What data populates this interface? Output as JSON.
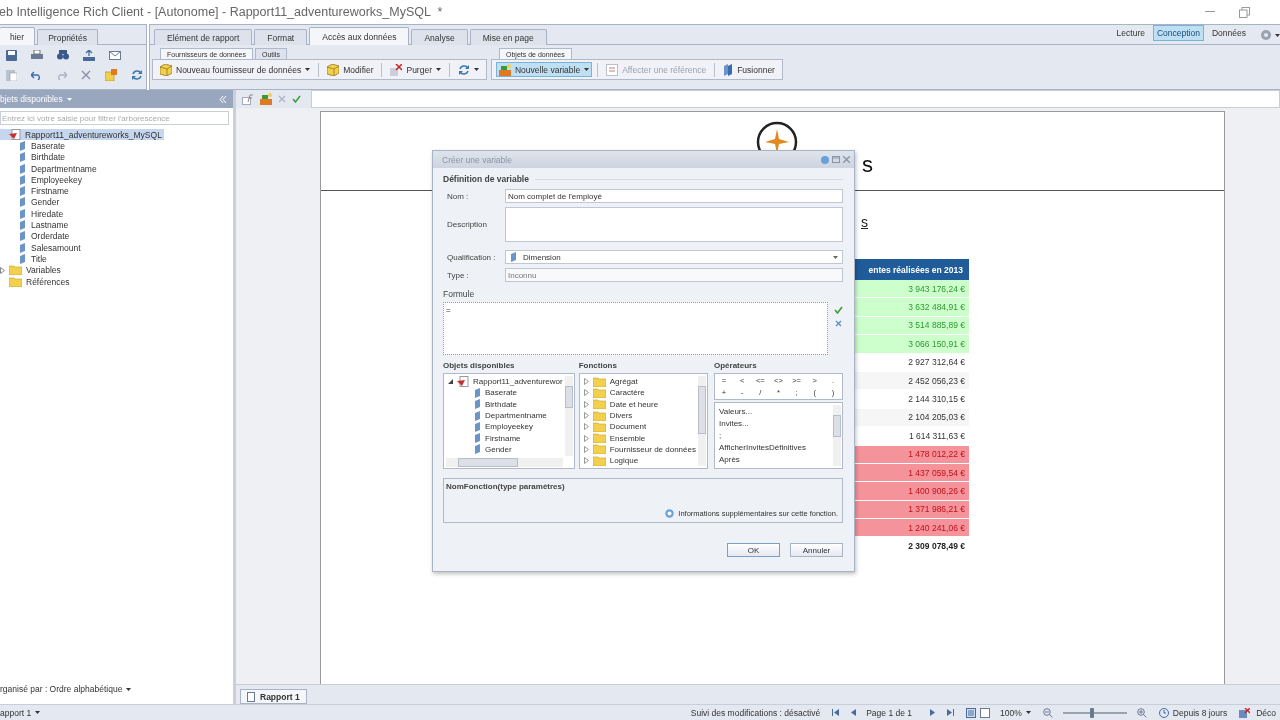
{
  "window": {
    "title": "eb Intelligence Rich Client - [Autonome] - Rapport11_adventureworks_MySQL  *"
  },
  "left_tabs": [
    {
      "label": "hier",
      "selected": true
    },
    {
      "label": "Propriétés",
      "selected": false
    }
  ],
  "ribbon_tabs": [
    {
      "label": "Elément de rapport",
      "selected": false
    },
    {
      "label": "Format",
      "selected": false
    },
    {
      "label": "Accès aux données",
      "selected": true
    },
    {
      "label": "Analyse",
      "selected": false
    },
    {
      "label": "Mise en page",
      "selected": false
    }
  ],
  "modes": [
    {
      "label": "Lecture",
      "selected": false
    },
    {
      "label": "Conception",
      "selected": true
    },
    {
      "label": "Données",
      "selected": false
    }
  ],
  "groups": [
    {
      "tabs": [
        {
          "label": "Fournisseurs de données",
          "selected": true
        },
        {
          "label": "Outils",
          "selected": false
        }
      ],
      "buttons": [
        {
          "label": "Nouveau fournisseur de données",
          "kind": "cube",
          "dropdown": true,
          "highlighted": false,
          "disabled": false
        },
        {
          "label": "Modifier",
          "kind": "cube",
          "dropdown": false,
          "highlighted": false,
          "disabled": false
        },
        {
          "label": "Purger",
          "kind": "purge",
          "dropdown": true,
          "highlighted": false,
          "disabled": false
        },
        {
          "kind": "refresh",
          "dropdown": true,
          "highlighted": false,
          "disabled": false
        }
      ]
    },
    {
      "tabs": [
        {
          "label": "Objets de données",
          "selected": true
        }
      ],
      "buttons": [
        {
          "label": "Nouvelle variable",
          "kind": "variable",
          "dropdown": true,
          "highlighted": true,
          "disabled": false
        },
        {
          "label": "Affecter une référence",
          "kind": "reference",
          "dropdown": false,
          "highlighted": false,
          "disabled": true
        },
        {
          "label": "Fusionner",
          "kind": "merge",
          "dropdown": false,
          "highlighted": false,
          "disabled": false
        }
      ]
    }
  ],
  "objects_panel": {
    "title": "bjets disponibles",
    "filter_placeholder": "Entrez ici votre saisie pour filtrer l'arborescence",
    "tree": [
      {
        "label": "Rapport11_adventureworks_MySQL",
        "kind": "report",
        "selected": true,
        "children": [
          {
            "label": "Baserate",
            "kind": "dimension",
            "selected": false
          },
          {
            "label": "Birthdate",
            "kind": "dimension",
            "selected": false
          },
          {
            "label": "Departmentname",
            "kind": "dimension",
            "selected": false
          },
          {
            "label": "Employeekey",
            "kind": "dimension",
            "selected": false
          },
          {
            "label": "Firstname",
            "kind": "dimension",
            "selected": false
          },
          {
            "label": "Gender",
            "kind": "dimension",
            "selected": false
          },
          {
            "label": "Hiredate",
            "kind": "dimension",
            "selected": false
          },
          {
            "label": "Lastname",
            "kind": "dimension",
            "selected": false
          },
          {
            "label": "Orderdate",
            "kind": "dimension",
            "selected": false
          },
          {
            "label": "Salesamount",
            "kind": "dimension",
            "selected": false
          },
          {
            "label": "Title",
            "kind": "dimension",
            "selected": false
          }
        ]
      },
      {
        "label": "Variables",
        "kind": "folder",
        "selected": false,
        "expanded": false
      },
      {
        "label": "Références",
        "kind": "folder",
        "selected": false
      }
    ],
    "sort": "rganisé par : Ordre alphabétique"
  },
  "report": {
    "title_tail": "s",
    "subtitle_tail": "s",
    "table": {
      "header": "entes réalisées en 2013",
      "rows": [
        {
          "value": "3 943 176,24 €",
          "kind": "high"
        },
        {
          "value": "3 632 484,91 €",
          "kind": "high"
        },
        {
          "value": "3 514 885,89 €",
          "kind": "high"
        },
        {
          "value": "3 066 150,91 €",
          "kind": "high"
        },
        {
          "value": "2 927 312,64 €",
          "kind": "mid"
        },
        {
          "value": "2 452 056,23 €",
          "kind": "mid"
        },
        {
          "value": "2 144 310,15 €",
          "kind": "mid"
        },
        {
          "value": "2 104 205,03 €",
          "kind": "mid"
        },
        {
          "value": "1 614 311,63 €",
          "kind": "mid"
        },
        {
          "value": "1 478 012,22 €",
          "kind": "low"
        },
        {
          "value": "1 437 059,54 €",
          "kind": "low"
        },
        {
          "value": "1 400 906,26 €",
          "kind": "low"
        },
        {
          "value": "1 371 986,21 €",
          "kind": "low"
        },
        {
          "value": "1 240 241,06 €",
          "kind": "low"
        }
      ],
      "total": "2 309 078,49 €"
    }
  },
  "report_tabs": [
    {
      "label": "Rapport 1",
      "selected": true
    }
  ],
  "status_bar": {
    "report": "apport 1",
    "tracking": "Suivi des modifications : désactivé",
    "page": "Page 1 de 1",
    "zoom": "100%",
    "zoom_slider": {
      "level": 0.45
    },
    "since": "Depuis 8 jours",
    "connection": "Déco"
  },
  "dialog": {
    "title": "Créer une variable",
    "section": "Définition de variable",
    "fields": [
      {
        "label": "Nom :",
        "kind": "text",
        "value": "Nom complet de l'employé"
      },
      {
        "label": "Description",
        "kind": "textarea"
      },
      {
        "label": "Qualification :",
        "kind": "select",
        "value": "Dimension"
      },
      {
        "label": "Type :",
        "kind": "readonly",
        "value": "Inconnu"
      }
    ],
    "formula_label": "Formule",
    "formula": "=",
    "objects_title": "Objets disponibles",
    "objects": {
      "label": "Rapport11_adventurewor",
      "children": [
        "Baserate",
        "Birthdate",
        "Departmentname",
        "Employeekey",
        "Firstname",
        "Gender"
      ]
    },
    "functions_title": "Fonctions",
    "functions": [
      "Agrégat",
      "Caractère",
      "Date et heure",
      "Divers",
      "Document",
      "Ensemble",
      "Fournisseur de données",
      "Logique"
    ],
    "operators_title": "Opérateurs",
    "operators": [
      "=",
      "<",
      "<=",
      "<>",
      ">=",
      ">",
      ".",
      "+",
      "-",
      "/",
      "*",
      ";",
      "(",
      ")"
    ],
    "operator_items": [
      "Valeurs...",
      "Invites...",
      ";",
      "AfficherInvitesDéfinitives",
      "Après"
    ],
    "signature": "NomFonction(type paramètres)",
    "help_link": "Informations supplémentaires sur cette fonction.",
    "buttons": [
      "OK",
      "Annuler"
    ]
  }
}
